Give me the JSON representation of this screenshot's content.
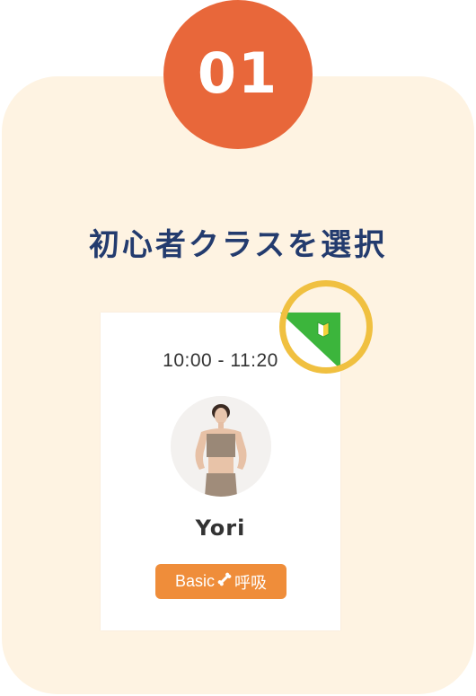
{
  "step": {
    "number": "01"
  },
  "heading": "初心者クラスを選択",
  "class_card": {
    "time": "10:00 - 11:20",
    "instructor_name": "Yori",
    "tag": {
      "prefix": "Basic",
      "suffix": "呼吸",
      "icon": "bone-icon"
    },
    "beginner_badge": {
      "icon": "beginner-mark-icon"
    }
  },
  "colors": {
    "accent_orange": "#e8673a",
    "card_bg": "#fef3e2",
    "heading_navy": "#233b6e",
    "tag_orange": "#ef8d3a",
    "badge_green": "#3cb53c",
    "ring_yellow": "#f0c040"
  }
}
